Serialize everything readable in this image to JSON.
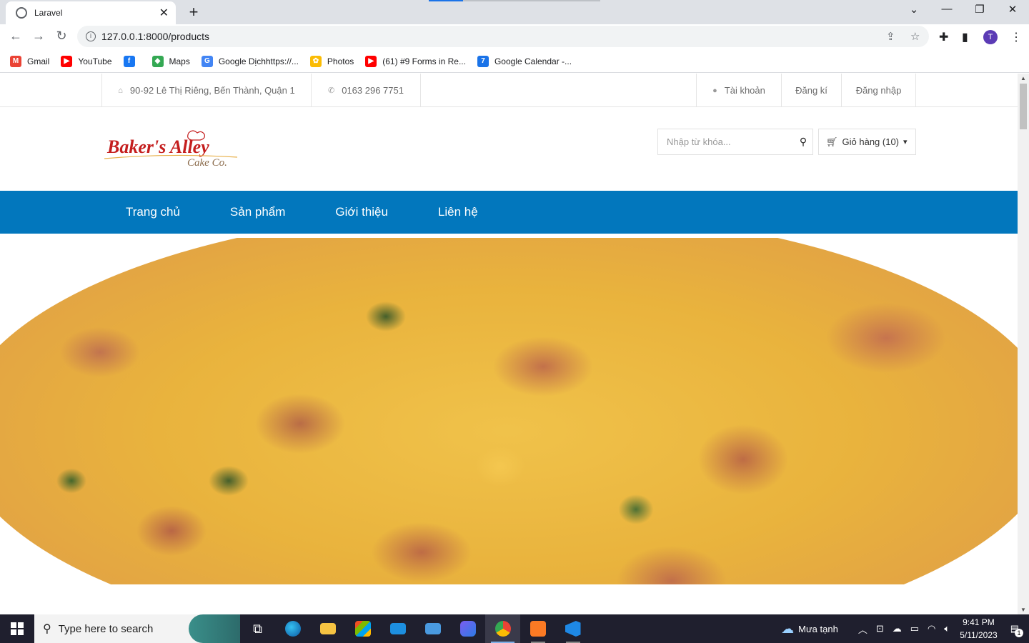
{
  "browser": {
    "tab_title": "Laravel",
    "url": "127.0.0.1:8000/products",
    "avatar_letter": "T",
    "bookmarks": [
      {
        "label": "Gmail",
        "icon": "gmail-icon",
        "color": "#ea4335",
        "glyph": "M"
      },
      {
        "label": "YouTube",
        "icon": "youtube-icon",
        "color": "#ff0000",
        "glyph": "▶"
      },
      {
        "label": "",
        "icon": "facebook-icon",
        "color": "#1877f2",
        "glyph": "f"
      },
      {
        "label": "Maps",
        "icon": "maps-icon",
        "color": "#34a853",
        "glyph": "◆"
      },
      {
        "label": "Google Dịchhttps://...",
        "icon": "translate-icon",
        "color": "#4285f4",
        "glyph": "G"
      },
      {
        "label": "Photos",
        "icon": "photos-icon",
        "color": "#fbbc04",
        "glyph": "✿"
      },
      {
        "label": "(61) #9 Forms in Re...",
        "icon": "youtube-icon",
        "color": "#ff0000",
        "glyph": "▶"
      },
      {
        "label": "Google Calendar -...",
        "icon": "calendar-icon",
        "color": "#1a73e8",
        "glyph": "7"
      }
    ]
  },
  "topbar": {
    "address": "90-92 Lê Thị Riêng, Bến Thành, Quận 1",
    "phone": "0163 296 7751",
    "account": "Tài khoản",
    "register": "Đăng kí",
    "login": "Đăng nhập"
  },
  "header": {
    "logo_text": "Baker's Alley",
    "logo_sub": "Cake Co.",
    "search_placeholder": "Nhập từ khóa...",
    "cart_label": "Giỏ hàng (10)"
  },
  "nav": {
    "items": [
      "Trang chủ",
      "Sản phẩm",
      "Giới thiệu",
      "Liên hệ"
    ]
  },
  "taskbar": {
    "search_placeholder": "Type here to search",
    "weather": "Mưa tạnh",
    "time": "9:41 PM",
    "date": "5/11/2023",
    "notifications": "1"
  },
  "colors": {
    "nav_bg": "#0277bd",
    "logo_red": "#c41e1e"
  }
}
